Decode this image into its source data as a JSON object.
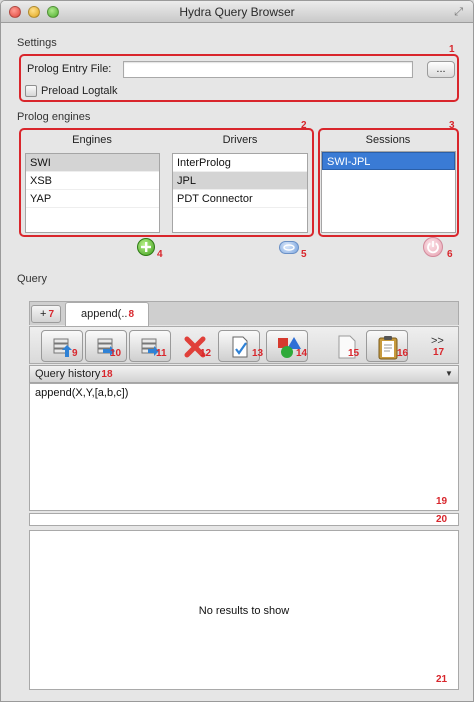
{
  "window": {
    "title": "Hydra Query Browser"
  },
  "settings": {
    "section_label": "Settings",
    "entry_file_label": "Prolog Entry File:",
    "entry_file_value": "",
    "browse_label": "...",
    "preload_label": "Preload Logtalk",
    "preload_checked": false
  },
  "prolog_engines": {
    "section_label": "Prolog engines",
    "engines_header": "Engines",
    "engines": [
      "SWI",
      "XSB",
      "YAP"
    ],
    "drivers_header": "Drivers",
    "drivers": [
      "InterProlog",
      "JPL",
      "PDT Connector"
    ],
    "sessions_header": "Sessions",
    "sessions": [
      "SWI-JPL"
    ]
  },
  "query": {
    "section_label": "Query",
    "tab_plus_label": "+",
    "tab_label": "append(..",
    "overflow_label": ">>",
    "history_label": "Query history",
    "query_text": "append(X,Y,[a,b,c])",
    "results_message": "No results to show"
  },
  "markers": [
    "1",
    "2",
    "3",
    "4",
    "5",
    "6",
    "7",
    "8",
    "9",
    "10",
    "11",
    "12",
    "13",
    "14",
    "15",
    "16",
    "17",
    "18",
    "19",
    "20",
    "21"
  ],
  "colors": {
    "marker_red": "#d8262c",
    "selection_blue": "#3a7bd5"
  }
}
